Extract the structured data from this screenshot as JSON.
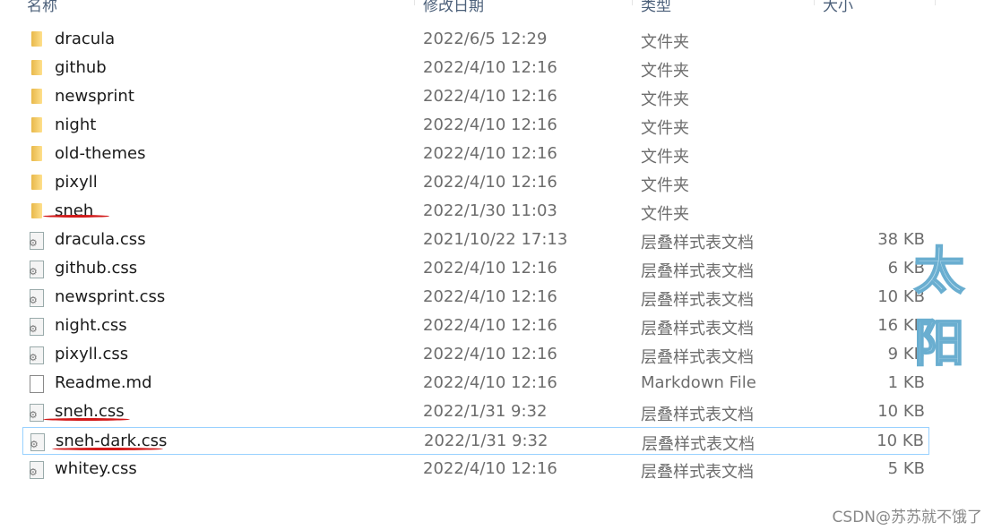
{
  "columns": {
    "name": "名称",
    "date": "修改日期",
    "type": "类型",
    "size": "大小"
  },
  "rows": [
    {
      "name": "dracula",
      "date": "2022/6/5 12:29",
      "type": "文件夹",
      "size": "",
      "icon": "folder-icon"
    },
    {
      "name": "github",
      "date": "2022/4/10 12:16",
      "type": "文件夹",
      "size": "",
      "icon": "folder-icon"
    },
    {
      "name": "newsprint",
      "date": "2022/4/10 12:16",
      "type": "文件夹",
      "size": "",
      "icon": "folder-icon"
    },
    {
      "name": "night",
      "date": "2022/4/10 12:16",
      "type": "文件夹",
      "size": "",
      "icon": "folder-icon"
    },
    {
      "name": "old-themes",
      "date": "2022/4/10 12:16",
      "type": "文件夹",
      "size": "",
      "icon": "folder-icon"
    },
    {
      "name": "pixyll",
      "date": "2022/4/10 12:16",
      "type": "文件夹",
      "size": "",
      "icon": "folder-icon"
    },
    {
      "name": "sneh",
      "date": "2022/1/30 11:03",
      "type": "文件夹",
      "size": "",
      "icon": "folder-icon"
    },
    {
      "name": "dracula.css",
      "date": "2021/10/22 17:13",
      "type": "层叠样式表文档",
      "size": "38 KB",
      "icon": "css-file-icon"
    },
    {
      "name": "github.css",
      "date": "2022/4/10 12:16",
      "type": "层叠样式表文档",
      "size": "6 KB",
      "icon": "css-file-icon"
    },
    {
      "name": "newsprint.css",
      "date": "2022/4/10 12:16",
      "type": "层叠样式表文档",
      "size": "10 KB",
      "icon": "css-file-icon"
    },
    {
      "name": "night.css",
      "date": "2022/4/10 12:16",
      "type": "层叠样式表文档",
      "size": "16 KB",
      "icon": "css-file-icon"
    },
    {
      "name": "pixyll.css",
      "date": "2022/4/10 12:16",
      "type": "层叠样式表文档",
      "size": "9 KB",
      "icon": "css-file-icon"
    },
    {
      "name": "Readme.md",
      "date": "2022/4/10 12:16",
      "type": "Markdown File",
      "size": "1 KB",
      "icon": "file-icon"
    },
    {
      "name": "sneh.css",
      "date": "2022/1/31 9:32",
      "type": "层叠样式表文档",
      "size": "10 KB",
      "icon": "css-file-icon"
    },
    {
      "name": "sneh-dark.css",
      "date": "2022/1/31 9:32",
      "type": "层叠样式表文档",
      "size": "10 KB",
      "icon": "css-file-icon",
      "selected": true
    },
    {
      "name": "whitey.css",
      "date": "2022/4/10 12:16",
      "type": "层叠样式表文档",
      "size": "5 KB",
      "icon": "css-file-icon"
    }
  ],
  "overlay_text": "太阳",
  "watermark": "CSDN@苏苏就不饿了",
  "colors": {
    "selection_border": "#99d1ff",
    "annotation": "#d21a1a"
  }
}
